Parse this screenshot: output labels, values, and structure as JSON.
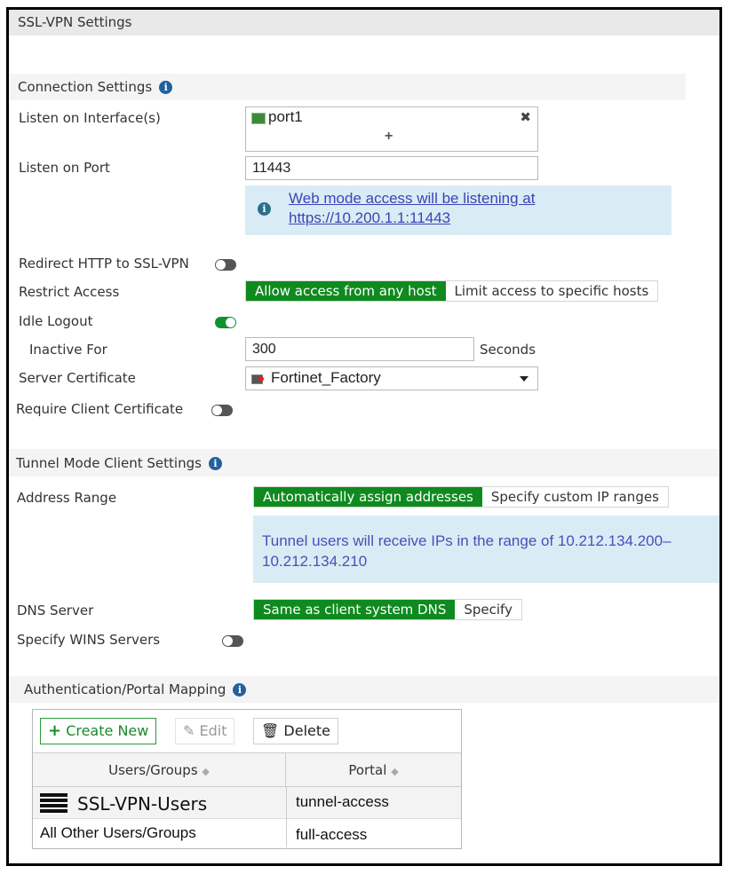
{
  "window": {
    "title": "SSL-VPN Settings"
  },
  "connection_settings": {
    "heading": "Connection Settings",
    "listen_on_interfaces": {
      "label": "Listen on Interface(s)",
      "items": [
        "port1"
      ],
      "add_symbol": "+",
      "remove_symbol": "✖"
    },
    "listen_on_port": {
      "label": "Listen on Port",
      "value": "11443"
    },
    "web_mode_info": {
      "line1": "Web mode access will be listening at",
      "line2": "https://10.200.1.1:11443"
    },
    "redirect_http": {
      "label": "Redirect HTTP to SSL-VPN",
      "enabled": false
    },
    "restrict_access": {
      "label": "Restrict Access",
      "options": [
        "Allow access from any host",
        "Limit access to specific hosts"
      ],
      "selected": "Allow access from any host"
    },
    "idle_logout": {
      "label": "Idle Logout",
      "enabled": true
    },
    "inactive_for": {
      "label": "Inactive For",
      "value": "300",
      "unit": "Seconds"
    },
    "server_certificate": {
      "label": "Server Certificate",
      "value": "Fortinet_Factory"
    },
    "require_client_certificate": {
      "label": "Require Client Certificate",
      "enabled": false
    }
  },
  "tunnel_mode": {
    "heading": "Tunnel Mode Client Settings",
    "address_range": {
      "label": "Address Range",
      "options": [
        "Automatically assign addresses",
        "Specify custom IP ranges"
      ],
      "selected": "Automatically assign addresses"
    },
    "range_info": {
      "line1": "Tunnel users will receive IPs in the range of 10.212.134.200–",
      "line2": "10.212.134.210"
    },
    "dns_server": {
      "label": "DNS Server",
      "options": [
        "Same as client system DNS",
        "Specify"
      ],
      "selected": "Same as client system DNS"
    },
    "wins_servers": {
      "label": "Specify WINS Servers",
      "enabled": false
    }
  },
  "auth_portal": {
    "heading": "Authentication/Portal Mapping",
    "toolbar": {
      "create_new": "Create New",
      "edit": "Edit",
      "delete": "Delete"
    },
    "columns": [
      "Users/Groups",
      "Portal"
    ],
    "rows": [
      {
        "users_groups": "SSL-VPN-Users",
        "portal": "tunnel-access",
        "icon": "user-group-icon"
      },
      {
        "users_groups": "All Other Users/Groups",
        "portal": "full-access"
      }
    ]
  },
  "colors": {
    "active_green": "#0f8a1f",
    "info_blue": "#22619c",
    "info_bg": "#d9ecf5",
    "link": "#3b44b8"
  }
}
